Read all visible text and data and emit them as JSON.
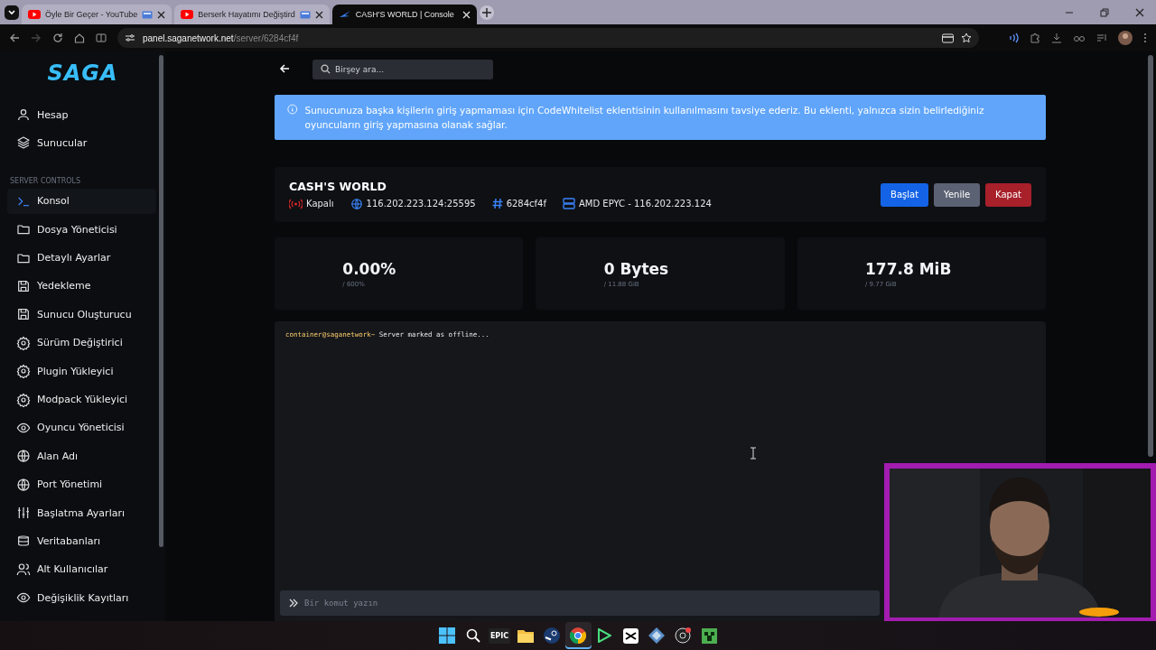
{
  "browser": {
    "tabs": [
      {
        "title": "Öyle Bir Geçer - YouTube",
        "selected": false,
        "kind": "youtube"
      },
      {
        "title": "Berserk Hayatımı Değiştird",
        "selected": false,
        "kind": "youtube"
      },
      {
        "title": "CASH'S WORLD | Console",
        "selected": true,
        "kind": "site"
      }
    ],
    "url_host": "panel.saganetwork.net",
    "url_path": "/server/6284cf4f"
  },
  "sidebar": {
    "logo": "SAGA",
    "items": [
      {
        "label": "Hesap",
        "selected": false
      },
      {
        "label": "Sunucular",
        "selected": false
      }
    ],
    "section": "SERVER CONTROLS",
    "controls": [
      {
        "label": "Konsol",
        "selected": true
      },
      {
        "label": "Dosya Yöneticisi",
        "selected": false
      },
      {
        "label": "Detaylı Ayarlar",
        "selected": false
      },
      {
        "label": "Yedekleme",
        "selected": false
      },
      {
        "label": "Sunucu Oluşturucu",
        "selected": false
      },
      {
        "label": "Sürüm Değiştirici",
        "selected": false
      },
      {
        "label": "Plugin Yükleyici",
        "selected": false
      },
      {
        "label": "Modpack Yükleyici",
        "selected": false
      },
      {
        "label": "Oyuncu Yöneticisi",
        "selected": false
      },
      {
        "label": "Alan Adı",
        "selected": false
      },
      {
        "label": "Port Yönetimi",
        "selected": false
      },
      {
        "label": "Başlatma Ayarları",
        "selected": false
      },
      {
        "label": "Veritabanları",
        "selected": false
      },
      {
        "label": "Alt Kullanıcılar",
        "selected": false
      },
      {
        "label": "Değişiklik Kayıtları",
        "selected": false
      }
    ]
  },
  "search": {
    "placeholder": "Birşey ara..."
  },
  "alert": {
    "text": "Sunucunuza başka kişilerin giriş yapmaması için CodeWhitelist eklentisinin kullanılmasını tavsiye ederiz. Bu eklenti, yalnızca sizin belirlediğiniz oyuncuların giriş yapmasına olanak sağlar."
  },
  "server": {
    "name": "CASH'S WORLD",
    "status": "Kapalı",
    "address": "116.202.223.124:25595",
    "id": "6284cf4f",
    "node": "AMD EPYC - 116.202.223.124",
    "buttons": [
      {
        "label": "Başlat",
        "kind": "primary"
      },
      {
        "label": "Yenile",
        "kind": "secondary"
      },
      {
        "label": "Kapat",
        "kind": "danger"
      }
    ]
  },
  "stats": [
    {
      "value": "0.00%",
      "limit": "/ 600%"
    },
    {
      "value": "0 Bytes",
      "limit": "/ 11.88 GiB"
    },
    {
      "value": "177.8 MiB",
      "limit": "/ 9.77 GiB"
    }
  ],
  "console": {
    "lines": [
      {
        "prompt": "container@saganetwork~",
        "text": "Server marked as offline..."
      }
    ],
    "placeholder": "Bir komut yazın"
  },
  "taskbar": [
    {
      "kind": "windows",
      "selected": false
    },
    {
      "kind": "search",
      "selected": false
    },
    {
      "kind": "epic",
      "label": "EPIC",
      "selected": false
    },
    {
      "kind": "folder",
      "selected": false
    },
    {
      "kind": "steam",
      "selected": false
    },
    {
      "kind": "chrome",
      "selected": true
    },
    {
      "kind": "play",
      "selected": false
    },
    {
      "kind": "capcut",
      "selected": false
    },
    {
      "kind": "cube",
      "selected": false
    },
    {
      "kind": "obs",
      "selected": false
    },
    {
      "kind": "creeper",
      "selected": false
    }
  ]
}
